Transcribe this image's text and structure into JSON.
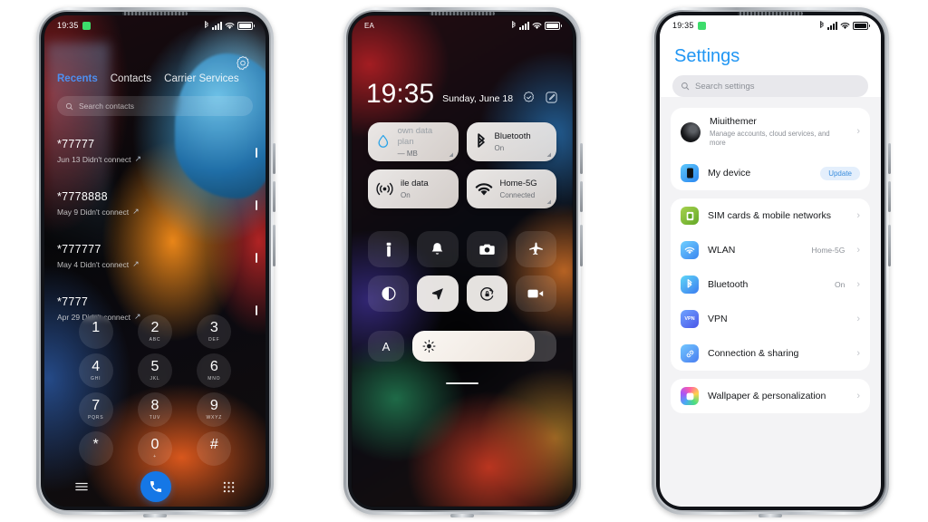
{
  "scene": {
    "background": "#ffffff",
    "phone_count": 3
  },
  "phone1": {
    "name": "dialer-phone",
    "statusbar": {
      "time": "19:35",
      "badge_icon": "green-app-badge",
      "icons": [
        "bluetooth-icon",
        "signal-icon",
        "wifi-icon",
        "battery-icon"
      ]
    },
    "header": {
      "settings_icon": "gear-icon"
    },
    "tabs": [
      {
        "label": "Recents",
        "active": true
      },
      {
        "label": "Contacts",
        "active": false
      },
      {
        "label": "Carrier Services",
        "active": false
      }
    ],
    "search": {
      "placeholder": "Search contacts",
      "icon": "search-icon"
    },
    "calls": [
      {
        "number": "*77777",
        "detail": "Jun 13 Didn't connect",
        "direction_icon": "outgoing-arrow-icon"
      },
      {
        "number": "*7778888",
        "detail": "May 9 Didn't connect",
        "direction_icon": "outgoing-arrow-icon"
      },
      {
        "number": "*777777",
        "detail": "May 4 Didn't connect",
        "direction_icon": "outgoing-arrow-icon"
      },
      {
        "number": "*7777",
        "detail": "Apr 29 Didn't connect",
        "direction_icon": "outgoing-arrow-icon"
      }
    ],
    "dialpad": {
      "keys": [
        {
          "digit": "1",
          "letters": ""
        },
        {
          "digit": "2",
          "letters": "ABC"
        },
        {
          "digit": "3",
          "letters": "DEF"
        },
        {
          "digit": "4",
          "letters": "GHI"
        },
        {
          "digit": "5",
          "letters": "JKL"
        },
        {
          "digit": "6",
          "letters": "MNO"
        },
        {
          "digit": "7",
          "letters": "PQRS"
        },
        {
          "digit": "8",
          "letters": "TUV"
        },
        {
          "digit": "9",
          "letters": "WXYZ"
        },
        {
          "digit": "*",
          "letters": ""
        },
        {
          "digit": "0",
          "letters": "+"
        },
        {
          "digit": "#",
          "letters": ""
        }
      ],
      "menu_icon": "menu-icon",
      "call_icon": "call-icon",
      "keypad_icon": "keypad-icon",
      "call_button_color": "#1577e6"
    }
  },
  "phone2": {
    "name": "control-center-phone",
    "statusbar": {
      "carrier": "EA",
      "icons": [
        "bluetooth-icon",
        "signal-icon",
        "wifi-icon",
        "battery-icon"
      ]
    },
    "clock": {
      "time": "19:35",
      "date": "Sunday, June 18"
    },
    "header_actions": [
      {
        "icon": "settings-badge-icon"
      },
      {
        "icon": "edit-icon"
      }
    ],
    "tiles": [
      {
        "title": "own data plan",
        "subtitle": "— MB",
        "icon": "data-drop-icon",
        "dimmed": true
      },
      {
        "title": "Bluetooth",
        "subtitle": "On",
        "icon": "bluetooth-icon",
        "dimmed": false
      },
      {
        "title": "ile data",
        "subtitle": "On",
        "icon": "mobile-data-icon",
        "dimmed": false
      },
      {
        "title": "Home-5G",
        "subtitle": "Connected",
        "icon": "wifi-icon",
        "dimmed": false
      }
    ],
    "toggles": [
      {
        "icon": "flashlight-icon",
        "on": false
      },
      {
        "icon": "bell-icon",
        "on": false
      },
      {
        "icon": "camera-icon",
        "on": false
      },
      {
        "icon": "airplane-icon",
        "on": false
      },
      {
        "icon": "dark-mode-icon",
        "on": false
      },
      {
        "icon": "location-icon",
        "on": true
      },
      {
        "icon": "rotation-lock-icon",
        "on": true
      },
      {
        "icon": "screen-record-icon",
        "on": false
      }
    ],
    "brightness": {
      "auto_label": "A",
      "icon": "brightness-sun-icon",
      "percent": 85
    }
  },
  "phone3": {
    "name": "settings-phone",
    "statusbar": {
      "time": "19:35",
      "badge_icon": "green-app-badge",
      "icons": [
        "bluetooth-icon",
        "signal-icon",
        "wifi-icon",
        "battery-icon"
      ]
    },
    "title": "Settings",
    "search": {
      "placeholder": "Search settings",
      "icon": "search-icon"
    },
    "account_card": [
      {
        "title": "Miuithemer",
        "subtitle": "Manage accounts, cloud services, and more",
        "icon": "avatar",
        "value": "",
        "badge": ""
      },
      {
        "title": "My device",
        "subtitle": "",
        "icon": "device-icon",
        "value": "",
        "badge": "Update",
        "icon_color": "#3ea5f5"
      }
    ],
    "connectivity_card": [
      {
        "title": "SIM cards & mobile networks",
        "value": "",
        "icon": "sim-card-icon",
        "icon_color": "#7cb342"
      },
      {
        "title": "WLAN",
        "value": "Home-5G",
        "icon": "wifi-icon",
        "icon_color": "#4fa8f5"
      },
      {
        "title": "Bluetooth",
        "value": "On",
        "icon": "bluetooth-icon",
        "icon_color": "#3fc1f0"
      },
      {
        "title": "VPN",
        "value": "",
        "icon": "vpn-icon",
        "icon_color": "#4a7bf7"
      },
      {
        "title": "Connection & sharing",
        "value": "",
        "icon": "link-icon",
        "icon_color": "#4aa3f5"
      }
    ],
    "personalization_card": [
      {
        "title": "Wallpaper & personalization",
        "value": "",
        "icon": "wallpaper-icon",
        "icon_color": "#e05aa8"
      }
    ],
    "accent_color": "#2196f3",
    "chevron": "›"
  }
}
